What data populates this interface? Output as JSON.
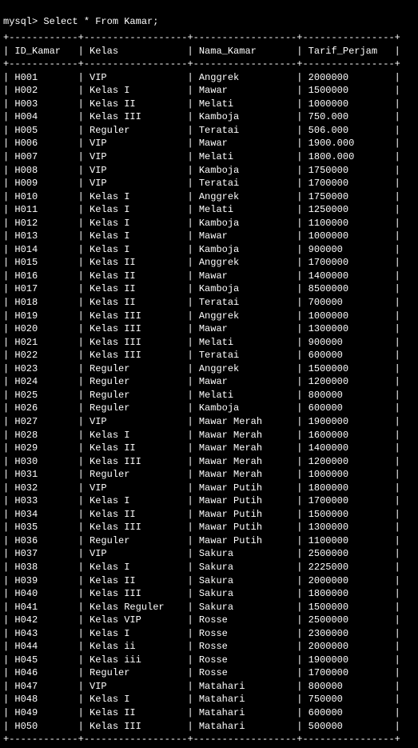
{
  "prompt": "mysql> Select * From Kamar;",
  "columns": [
    "ID_Kamar",
    "Kelas",
    "Nama_Kamar",
    "Tarif_Perjam"
  ],
  "rows": [
    [
      "H001",
      "VIP",
      "Anggrek",
      "2000000"
    ],
    [
      "H002",
      "Kelas I",
      "Mawar",
      "1500000"
    ],
    [
      "H003",
      "Kelas II",
      "Melati",
      "1000000"
    ],
    [
      "H004",
      "Kelas III",
      "Kamboja",
      "750.000"
    ],
    [
      "H005",
      "Reguler",
      "Teratai",
      "506.000"
    ],
    [
      "H006",
      "VIP",
      "Mawar",
      "1900.000"
    ],
    [
      "H007",
      "VIP",
      "Melati",
      "1800.000"
    ],
    [
      "H008",
      "VIP",
      "Kamboja",
      "1750000"
    ],
    [
      "H009",
      "VIP",
      "Teratai",
      "1700000"
    ],
    [
      "H010",
      "Kelas I",
      "Anggrek",
      "1750000"
    ],
    [
      "H011",
      "Kelas I",
      "Melati",
      "1250000"
    ],
    [
      "H012",
      "Kelas I",
      "Kamboja",
      "1100000"
    ],
    [
      "H013",
      "Kelas I",
      "Mawar",
      "1000000"
    ],
    [
      "H014",
      "Kelas I",
      "Kamboja",
      "900000"
    ],
    [
      "H015",
      "Kelas II",
      "Anggrek",
      "1700000"
    ],
    [
      "H016",
      "Kelas II",
      "Mawar",
      "1400000"
    ],
    [
      "H017",
      "Kelas II",
      "Kamboja",
      "8500000"
    ],
    [
      "H018",
      "Kelas II",
      "Teratai",
      "700000"
    ],
    [
      "H019",
      "Kelas III",
      "Anggrek",
      "1000000"
    ],
    [
      "H020",
      "Kelas III",
      "Mawar",
      "1300000"
    ],
    [
      "H021",
      "Kelas III",
      "Melati",
      "900000"
    ],
    [
      "H022",
      "Kelas III",
      "Teratai",
      "600000"
    ],
    [
      "H023",
      "Reguler",
      "Anggrek",
      "1500000"
    ],
    [
      "H024",
      "Reguler",
      "Mawar",
      "1200000"
    ],
    [
      "H025",
      "Reguler",
      "Melati",
      "800000"
    ],
    [
      "H026",
      "Reguler",
      "Kamboja",
      "600000"
    ],
    [
      "H027",
      "VIP",
      "Mawar Merah",
      "1900000"
    ],
    [
      "H028",
      "Kelas I",
      "Mawar Merah",
      "1600000"
    ],
    [
      "H029",
      "Kelas II",
      "Mawar Merah",
      "1400000"
    ],
    [
      "H030",
      "Kelas III",
      "Mawar Merah",
      "1200000"
    ],
    [
      "H031",
      "Reguler",
      "Mawar Merah",
      "1000000"
    ],
    [
      "H032",
      "VIP",
      "Mawar Putih",
      "1800000"
    ],
    [
      "H033",
      "Kelas I",
      "Mawar Putih",
      "1700000"
    ],
    [
      "H034",
      "Kelas II",
      "Mawar Putih",
      "1500000"
    ],
    [
      "H035",
      "Kelas III",
      "Mawar Putih",
      "1300000"
    ],
    [
      "H036",
      "Reguler",
      "Mawar Putih",
      "1100000"
    ],
    [
      "H037",
      "VIP",
      "Sakura",
      "2500000"
    ],
    [
      "H038",
      "Kelas I",
      "Sakura",
      "2225000"
    ],
    [
      "H039",
      "Kelas II",
      "Sakura",
      "2000000"
    ],
    [
      "H040",
      "Kelas III",
      "Sakura",
      "1800000"
    ],
    [
      "H041",
      "Kelas Reguler",
      "Sakura",
      "1500000"
    ],
    [
      "H042",
      "Kelas VIP",
      "Rosse",
      "2500000"
    ],
    [
      "H043",
      "Kelas I",
      "Rosse",
      "2300000"
    ],
    [
      "H044",
      "Kelas ii",
      "Rosse",
      "2000000"
    ],
    [
      "H045",
      "Kelas iii",
      "Rosse",
      "1900000"
    ],
    [
      "H046",
      "Reguler",
      "Rosse",
      "1700000"
    ],
    [
      "H047",
      "VIP",
      "Matahari",
      "800000"
    ],
    [
      "H048",
      "Kelas I",
      "Matahari",
      "750000"
    ],
    [
      "H049",
      "Kelas II",
      "Matahari",
      "600000"
    ],
    [
      "H050",
      "Kelas III",
      "Matahari",
      "500000"
    ]
  ]
}
